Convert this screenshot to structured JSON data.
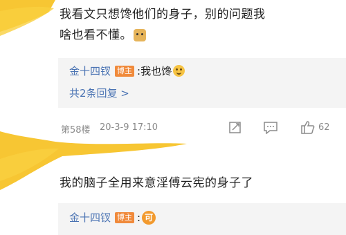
{
  "comment1": {
    "line1": "我看文只想馋他们的身子，别的问题我",
    "line2": "啥也看不懂。",
    "emoji_icon": "doge-icon"
  },
  "reply1": {
    "user": "金十四钗",
    "badge": "博主",
    "text": ":我也馋",
    "emoji_icon": "smile-icon"
  },
  "more_replies": "共2条回复 >",
  "meta": {
    "floor": "第58楼",
    "date": "20-3-9 17:10",
    "like_count": "62"
  },
  "comment2": {
    "text": "我的脑子全用来意淫傅云宪的身子了"
  },
  "reply2": {
    "user": "金十四钗",
    "badge": "博主",
    "colon": ":",
    "ke": "可"
  },
  "colors": {
    "scribble": "#f7c328",
    "link": "#4a73b3",
    "badge": "#f08a3b"
  }
}
